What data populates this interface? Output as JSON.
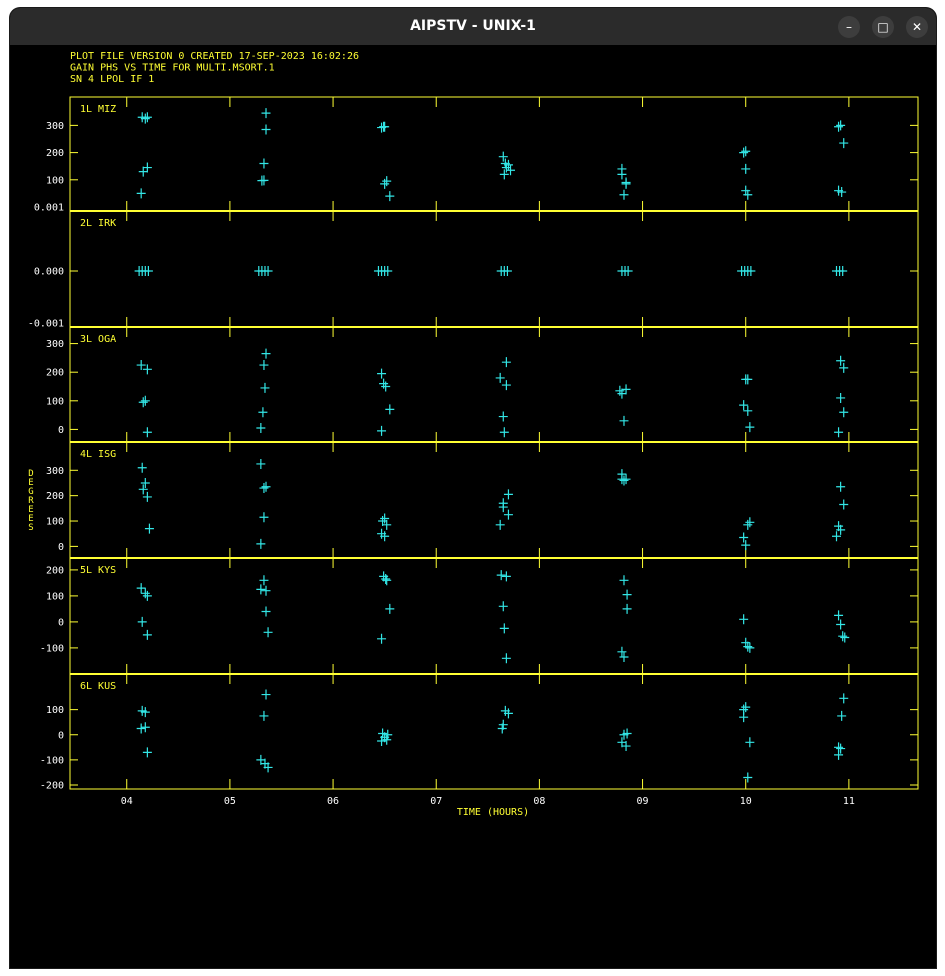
{
  "window": {
    "title": "AIPSTV - UNIX-1",
    "minimize_icon": "minimize-icon",
    "maximize_icon": "maximize-icon",
    "close_icon": "close-icon"
  },
  "header": {
    "line1": "PLOT FILE VERSION 0  CREATED 17-SEP-2023 16:02:26",
    "line2": "GAIN PHS VS TIME FOR MULTI.MSORT.1",
    "line3": "SN 4  LPOL  IF 1"
  },
  "colors": {
    "axes": "#ffff33",
    "points": "#33e6e6",
    "background": "#000000"
  },
  "chart_data": {
    "type": "scatter",
    "marker": "plus",
    "xlabel": "TIME (HOURS)",
    "ylabel": "DEGREES",
    "xlim": [
      3.45,
      11.67
    ],
    "xticks": [
      4,
      5,
      6,
      7,
      8,
      9,
      10,
      11
    ],
    "xtick_labels": [
      "04",
      "05",
      "06",
      "07",
      "08",
      "09",
      "10",
      "11"
    ],
    "panels": [
      {
        "name": "1L MIZ",
        "ylim": [
          0.001,
          375
        ],
        "yticks": [
          100,
          200,
          300
        ],
        "ytick_labels": [
          "100",
          "200",
          "300"
        ],
        "extra_ytick_labels": [
          {
            "value": 0.001,
            "label": "0.001"
          }
        ],
        "points": [
          [
            4.15,
            330
          ],
          [
            4.18,
            325
          ],
          [
            4.2,
            330
          ],
          [
            4.14,
            50
          ],
          [
            4.16,
            130
          ],
          [
            4.2,
            145
          ],
          [
            5.35,
            345
          ],
          [
            5.35,
            285
          ],
          [
            5.33,
            160
          ],
          [
            5.31,
            97
          ],
          [
            5.33,
            98
          ],
          [
            6.47,
            292
          ],
          [
            6.5,
            295
          ],
          [
            6.49,
            295
          ],
          [
            6.5,
            85
          ],
          [
            6.52,
            95
          ],
          [
            6.55,
            40
          ],
          [
            7.65,
            185
          ],
          [
            7.67,
            160
          ],
          [
            7.68,
            145
          ],
          [
            7.7,
            155
          ],
          [
            7.66,
            120
          ],
          [
            7.72,
            135
          ],
          [
            8.8,
            120
          ],
          [
            8.8,
            140
          ],
          [
            8.84,
            85
          ],
          [
            8.84,
            90
          ],
          [
            8.82,
            45
          ],
          [
            9.98,
            200
          ],
          [
            10,
            205
          ],
          [
            10,
            140
          ],
          [
            10,
            60
          ],
          [
            10.02,
            45
          ],
          [
            10.9,
            295
          ],
          [
            10.92,
            300
          ],
          [
            10.95,
            235
          ],
          [
            10.9,
            60
          ],
          [
            10.93,
            55
          ]
        ]
      },
      {
        "name": "2L IRK",
        "ylim": [
          -0.001,
          0.001
        ],
        "yticks": [
          0
        ],
        "ytick_labels": [
          "0.000"
        ],
        "extra_ytick_labels": [
          {
            "value": -0.001,
            "label": "-0.001"
          }
        ],
        "points": [
          [
            4.12,
            0
          ],
          [
            4.15,
            0
          ],
          [
            4.18,
            0
          ],
          [
            4.21,
            0
          ],
          [
            5.28,
            0
          ],
          [
            5.31,
            0
          ],
          [
            5.34,
            0
          ],
          [
            5.37,
            0
          ],
          [
            6.44,
            0
          ],
          [
            6.47,
            0
          ],
          [
            6.5,
            0
          ],
          [
            6.53,
            0
          ],
          [
            7.63,
            0
          ],
          [
            7.66,
            0
          ],
          [
            7.69,
            0
          ],
          [
            8.8,
            0
          ],
          [
            8.83,
            0
          ],
          [
            8.86,
            0
          ],
          [
            9.96,
            0
          ],
          [
            9.99,
            0
          ],
          [
            10.02,
            0
          ],
          [
            10.05,
            0
          ],
          [
            10.88,
            0
          ],
          [
            10.91,
            0
          ],
          [
            10.94,
            0
          ]
        ]
      },
      {
        "name": "3L OGA",
        "ylim": [
          -30,
          330
        ],
        "yticks": [
          0,
          100,
          200,
          300
        ],
        "ytick_labels": [
          "0",
          "100",
          "200",
          "300"
        ],
        "points": [
          [
            4.14,
            225
          ],
          [
            4.2,
            210
          ],
          [
            4.16,
            95
          ],
          [
            4.18,
            100
          ],
          [
            4.2,
            -10
          ],
          [
            5.35,
            265
          ],
          [
            5.33,
            225
          ],
          [
            5.34,
            145
          ],
          [
            5.32,
            60
          ],
          [
            5.3,
            5
          ],
          [
            6.47,
            195
          ],
          [
            6.49,
            160
          ],
          [
            6.51,
            150
          ],
          [
            6.55,
            70
          ],
          [
            6.47,
            -5
          ],
          [
            7.62,
            180
          ],
          [
            7.68,
            155
          ],
          [
            7.68,
            235
          ],
          [
            7.65,
            45
          ],
          [
            7.66,
            -10
          ],
          [
            8.78,
            135
          ],
          [
            8.8,
            125
          ],
          [
            8.84,
            140
          ],
          [
            8.82,
            30
          ],
          [
            9.98,
            85
          ],
          [
            10,
            175
          ],
          [
            10.02,
            175
          ],
          [
            10.02,
            65
          ],
          [
            10.04,
            8
          ],
          [
            10.92,
            240
          ],
          [
            10.95,
            215
          ],
          [
            10.92,
            110
          ],
          [
            10.95,
            60
          ],
          [
            10.9,
            -10
          ]
        ]
      },
      {
        "name": "4L ISG",
        "ylim": [
          -30,
          380
        ],
        "yticks": [
          0,
          100,
          200,
          300
        ],
        "ytick_labels": [
          "0",
          "100",
          "200",
          "300"
        ],
        "points": [
          [
            4.15,
            310
          ],
          [
            4.18,
            250
          ],
          [
            4.16,
            225
          ],
          [
            4.2,
            195
          ],
          [
            4.22,
            70
          ],
          [
            5.3,
            325
          ],
          [
            5.35,
            235
          ],
          [
            5.33,
            230
          ],
          [
            5.33,
            115
          ],
          [
            5.3,
            10
          ],
          [
            6.48,
            100
          ],
          [
            6.5,
            110
          ],
          [
            6.52,
            85
          ],
          [
            6.47,
            50
          ],
          [
            6.5,
            40
          ],
          [
            7.65,
            170
          ],
          [
            7.65,
            155
          ],
          [
            7.7,
            205
          ],
          [
            7.7,
            125
          ],
          [
            7.62,
            85
          ],
          [
            8.8,
            285
          ],
          [
            8.8,
            265
          ],
          [
            8.84,
            265
          ],
          [
            8.82,
            260
          ],
          [
            9.98,
            35
          ],
          [
            10.02,
            85
          ],
          [
            10.04,
            95
          ],
          [
            10,
            5
          ],
          [
            10.92,
            235
          ],
          [
            10.95,
            165
          ],
          [
            10.9,
            80
          ],
          [
            10.92,
            65
          ],
          [
            10.88,
            40
          ]
        ]
      },
      {
        "name": "5L KYS",
        "ylim": [
          -185,
          215
        ],
        "yticks": [
          -100,
          0,
          100,
          200
        ],
        "ytick_labels": [
          "-100",
          "0",
          "100",
          "200"
        ],
        "points": [
          [
            4.14,
            130
          ],
          [
            4.18,
            110
          ],
          [
            4.2,
            100
          ],
          [
            4.15,
            0
          ],
          [
            4.2,
            -50
          ],
          [
            5.33,
            160
          ],
          [
            5.3,
            125
          ],
          [
            5.35,
            120
          ],
          [
            5.35,
            40
          ],
          [
            5.37,
            -40
          ],
          [
            6.49,
            175
          ],
          [
            6.51,
            165
          ],
          [
            6.52,
            160
          ],
          [
            6.55,
            50
          ],
          [
            6.47,
            -65
          ],
          [
            7.63,
            180
          ],
          [
            7.68,
            175
          ],
          [
            7.65,
            60
          ],
          [
            7.66,
            -25
          ],
          [
            7.68,
            -140
          ],
          [
            8.82,
            160
          ],
          [
            8.85,
            105
          ],
          [
            8.85,
            50
          ],
          [
            8.8,
            -115
          ],
          [
            8.82,
            -135
          ],
          [
            9.98,
            10
          ],
          [
            10,
            -80
          ],
          [
            10.02,
            -95
          ],
          [
            10.04,
            -100
          ],
          [
            10.9,
            25
          ],
          [
            10.92,
            -10
          ],
          [
            10.94,
            -55
          ],
          [
            10.96,
            -60
          ]
        ]
      },
      {
        "name": "6L KUS",
        "ylim": [
          -200,
          210
        ],
        "yticks": [
          -200,
          -100,
          0,
          100
        ],
        "ytick_labels": [
          "-200",
          "-100",
          "0",
          "100"
        ],
        "points": [
          [
            4.15,
            95
          ],
          [
            4.18,
            90
          ],
          [
            4.14,
            25
          ],
          [
            4.18,
            30
          ],
          [
            4.2,
            -70
          ],
          [
            5.35,
            160
          ],
          [
            5.33,
            75
          ],
          [
            5.3,
            -100
          ],
          [
            5.34,
            -115
          ],
          [
            5.37,
            -130
          ],
          [
            6.48,
            5
          ],
          [
            6.5,
            -10
          ],
          [
            6.52,
            -20
          ],
          [
            6.47,
            -25
          ],
          [
            6.53,
            0
          ],
          [
            7.67,
            95
          ],
          [
            7.7,
            85
          ],
          [
            7.65,
            40
          ],
          [
            7.64,
            25
          ],
          [
            8.82,
            0
          ],
          [
            8.85,
            5
          ],
          [
            8.8,
            -30
          ],
          [
            8.84,
            -45
          ],
          [
            9.98,
            100
          ],
          [
            10,
            110
          ],
          [
            9.98,
            70
          ],
          [
            10.04,
            -30
          ],
          [
            10.02,
            -170
          ],
          [
            10.95,
            145
          ],
          [
            10.93,
            75
          ],
          [
            10.9,
            -50
          ],
          [
            10.92,
            -55
          ],
          [
            10.9,
            -80
          ]
        ]
      }
    ]
  }
}
